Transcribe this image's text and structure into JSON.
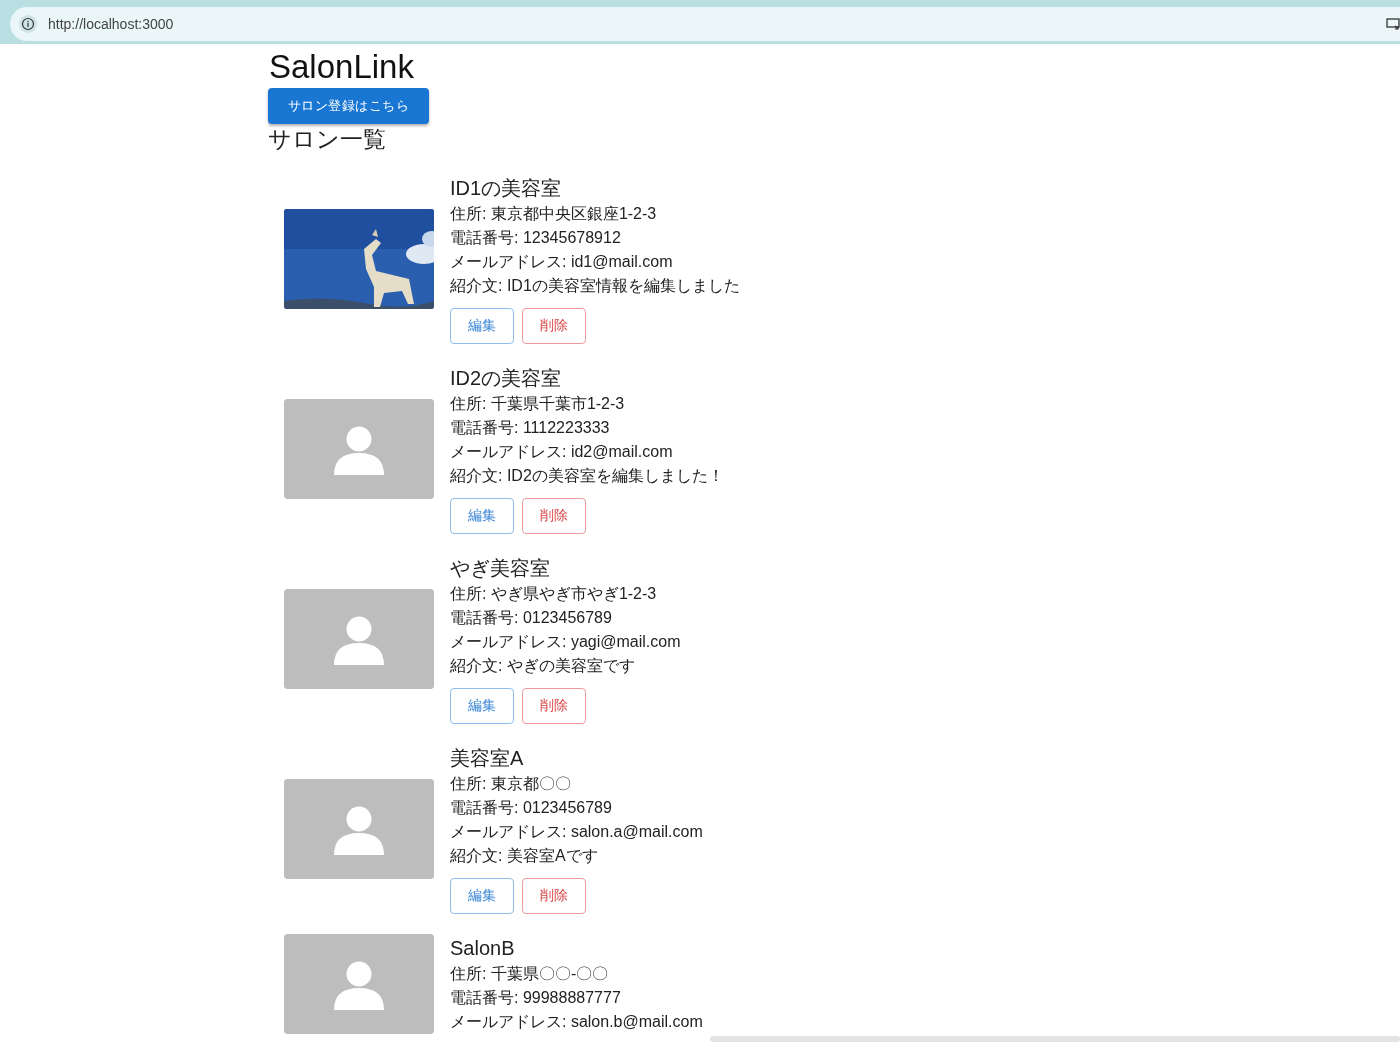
{
  "browser": {
    "url": "http://localhost:3000"
  },
  "app_title": "SalonLink",
  "register_button": "サロン登録はこちら",
  "list_heading": "サロン一覧",
  "salons": [
    {
      "image": {
        "kind": "picture"
      },
      "name": "ID1の美容室",
      "lines": [
        "住所: 東京都中央区銀座1-2-3",
        "電話番号: 12345678912",
        "メールアドレス: id1@mail.com",
        "紹介文: ID1の美容室情報を編集しました"
      ],
      "buttons": [
        {
          "kind": "edit",
          "label": "編集"
        },
        {
          "kind": "delete",
          "label": "削除"
        }
      ]
    },
    {
      "image": {
        "kind": "placeholder"
      },
      "name": "ID2の美容室",
      "lines": [
        "住所: 千葉県千葉市1-2-3",
        "電話番号: 1112223333",
        "メールアドレス: id2@mail.com",
        "紹介文: ID2の美容室を編集しました！"
      ],
      "buttons": [
        {
          "kind": "edit",
          "label": "編集"
        },
        {
          "kind": "delete",
          "label": "削除"
        }
      ]
    },
    {
      "image": {
        "kind": "placeholder"
      },
      "name": "やぎ美容室",
      "lines": [
        "住所: やぎ県やぎ市やぎ1-2-3",
        "電話番号: 0123456789",
        "メールアドレス: yagi@mail.com",
        "紹介文: やぎの美容室です"
      ],
      "buttons": [
        {
          "kind": "edit",
          "label": "編集"
        },
        {
          "kind": "delete",
          "label": "削除"
        }
      ]
    },
    {
      "image": {
        "kind": "placeholder"
      },
      "name": "美容室A",
      "lines": [
        "住所: 東京都〇〇",
        "電話番号: 0123456789",
        "メールアドレス: salon.a@mail.com",
        "紹介文: 美容室Aです"
      ],
      "buttons": [
        {
          "kind": "edit",
          "label": "編集"
        },
        {
          "kind": "delete",
          "label": "削除"
        }
      ]
    },
    {
      "image": {
        "kind": "placeholder"
      },
      "name": "SalonB",
      "lines": [
        "住所: 千葉県〇〇-〇〇",
        "電話番号: 99988887777",
        "メールアドレス: salon.b@mail.com"
      ]
    }
  ]
}
